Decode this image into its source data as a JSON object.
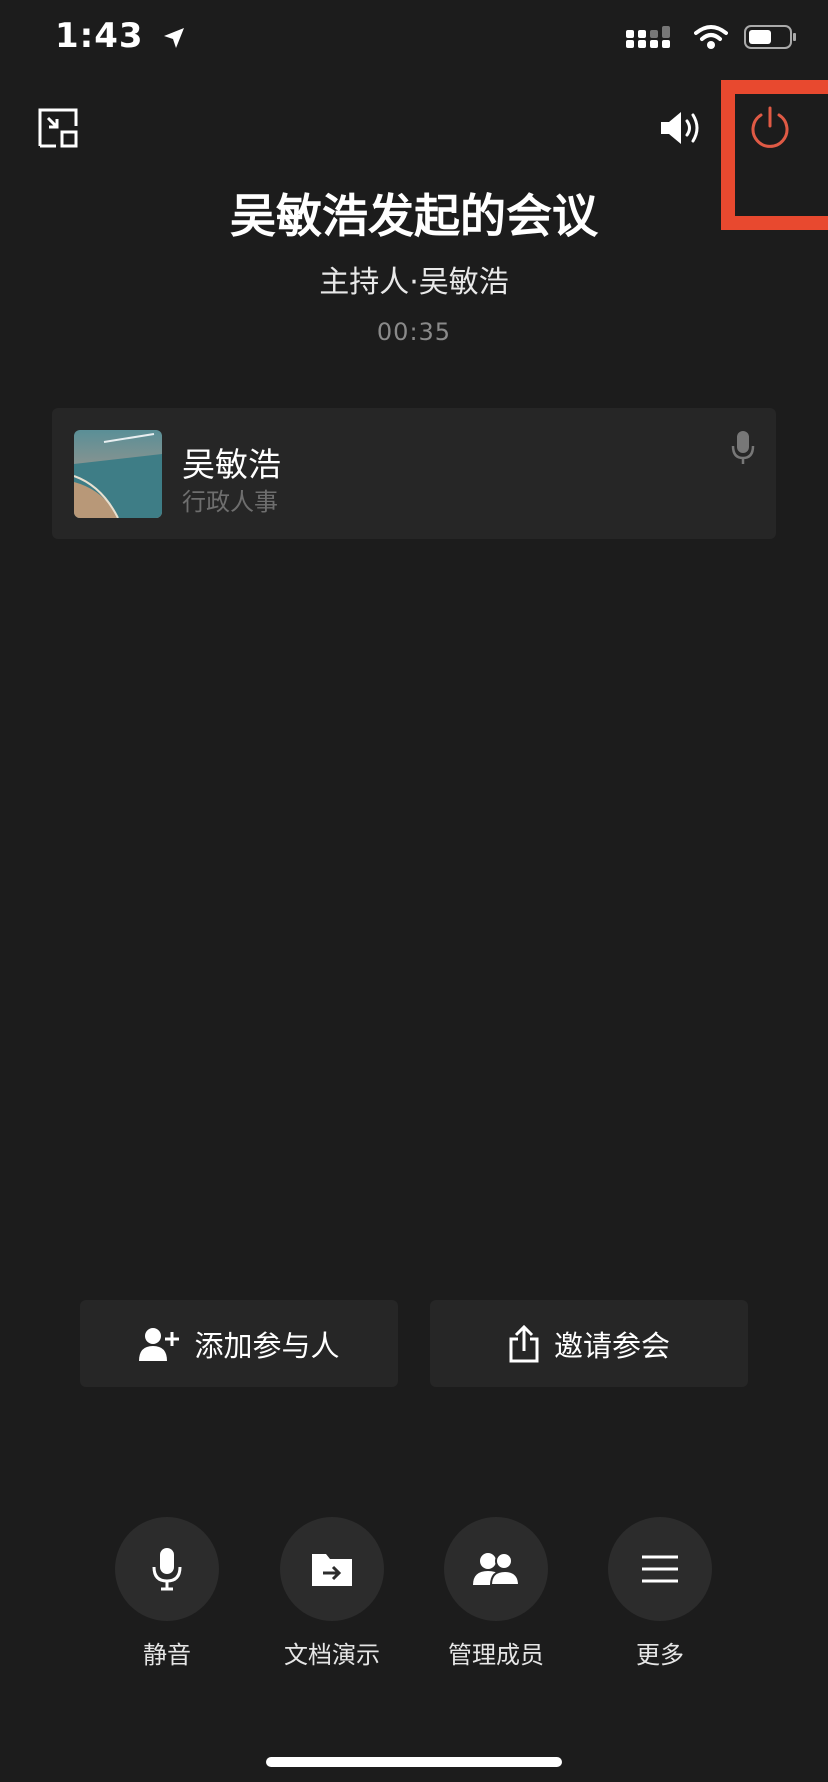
{
  "status_bar": {
    "time": "1:43"
  },
  "meeting": {
    "title": "吴敏浩发起的会议",
    "host_line": "主持人·吴敏浩",
    "elapsed": "00:35"
  },
  "participants": [
    {
      "name": "吴敏浩",
      "department": "行政人事"
    }
  ],
  "actions": {
    "add_participant_label": "添加参与人",
    "invite_label": "邀请参会"
  },
  "controls": {
    "mute_label": "静音",
    "doc_present_label": "文档演示",
    "manage_members_label": "管理成员",
    "more_label": "更多"
  },
  "colors": {
    "hangup": "#e05a45",
    "highlight": "#e8492f",
    "background": "#1c1c1c"
  }
}
